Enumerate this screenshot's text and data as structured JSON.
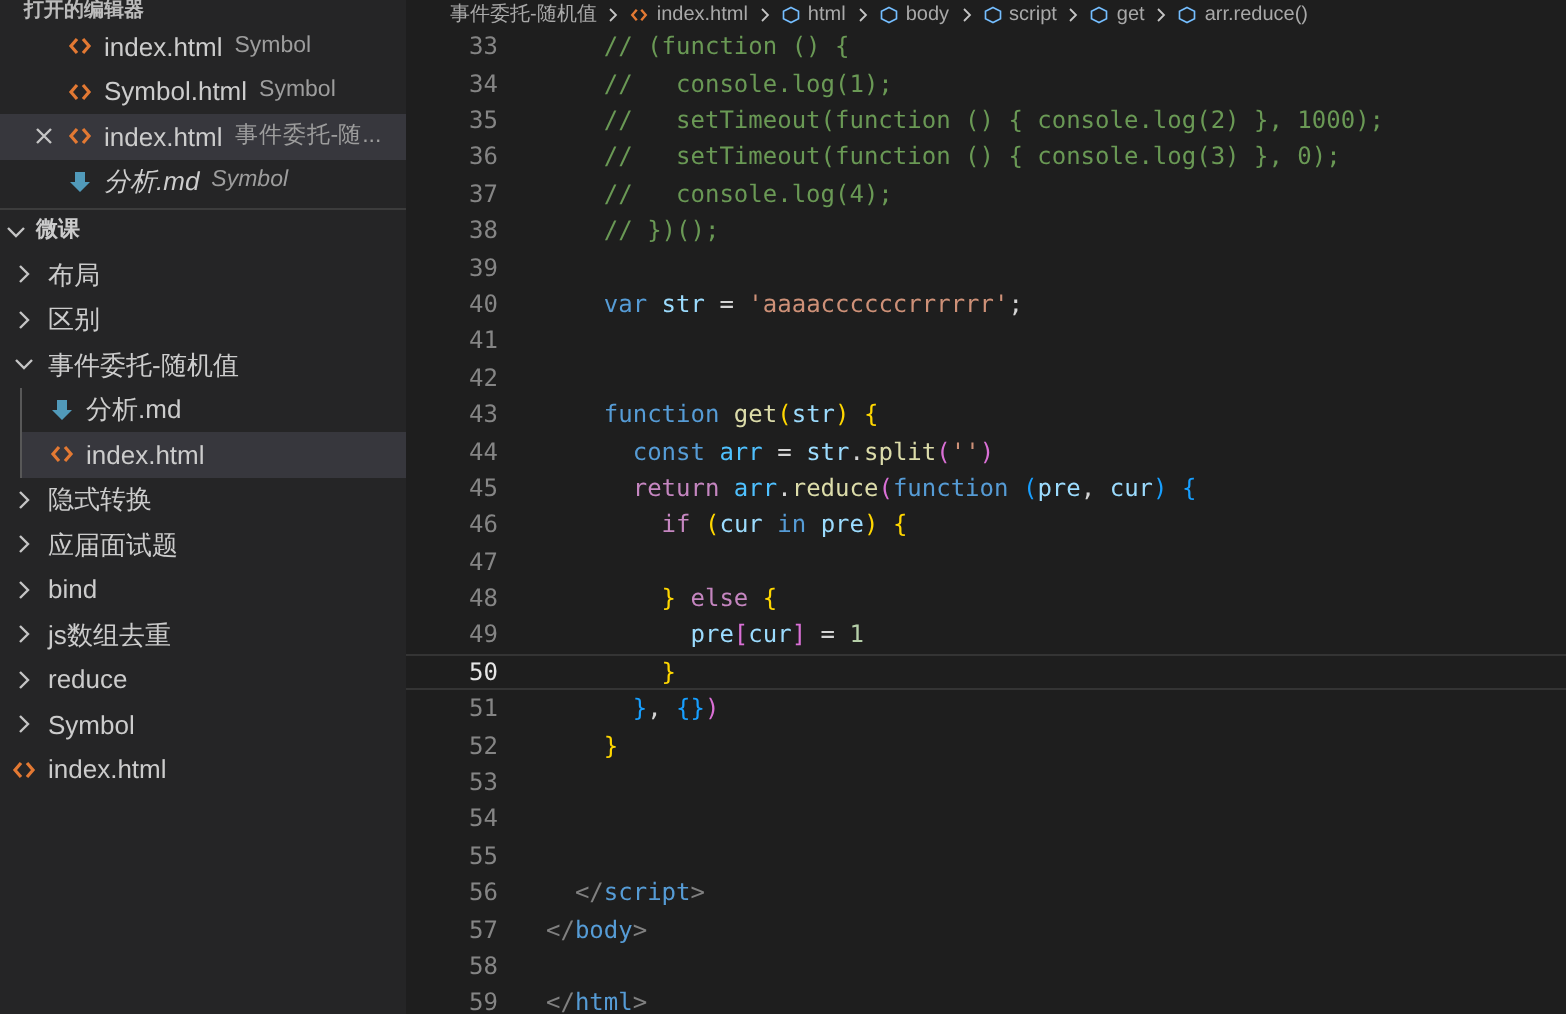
{
  "sidebar": {
    "open_editors": {
      "title": "打开的编辑器",
      "items": [
        {
          "kind": "html",
          "name": "index.html",
          "description": "Symbol",
          "selected": false,
          "preview": false
        },
        {
          "kind": "html",
          "name": "Symbol.html",
          "description": "Symbol",
          "selected": false,
          "preview": false
        },
        {
          "kind": "html",
          "name": "index.html",
          "description": "事件委托-随...",
          "selected": true,
          "preview": false
        },
        {
          "kind": "md",
          "name": "分析.md",
          "description": "Symbol",
          "selected": false,
          "preview": true
        }
      ]
    },
    "explorer": {
      "name": "微课",
      "expanded": true,
      "children": [
        {
          "kind": "folder",
          "name": "布局",
          "expanded": false,
          "selected": false
        },
        {
          "kind": "folder",
          "name": "区别",
          "expanded": false,
          "selected": false
        },
        {
          "kind": "folder",
          "name": "事件委托-随机值",
          "expanded": true,
          "selected": false,
          "children": [
            {
              "kind": "md",
              "name": "分析.md",
              "selected": false
            },
            {
              "kind": "html",
              "name": "index.html",
              "selected": true
            }
          ]
        },
        {
          "kind": "folder",
          "name": "隐式转换",
          "expanded": false,
          "selected": false
        },
        {
          "kind": "folder",
          "name": "应届面试题",
          "expanded": false,
          "selected": false
        },
        {
          "kind": "folder",
          "name": "bind",
          "expanded": false,
          "selected": false
        },
        {
          "kind": "folder",
          "name": "js数组去重",
          "expanded": false,
          "selected": false
        },
        {
          "kind": "folder",
          "name": "reduce",
          "expanded": false,
          "selected": false
        },
        {
          "kind": "folder",
          "name": "Symbol",
          "expanded": false,
          "selected": false
        },
        {
          "kind": "html",
          "name": "index.html",
          "selected": false
        }
      ]
    }
  },
  "editor": {
    "breadcrumbs": [
      "事件委托-随机值",
      "index.html",
      "html",
      "body",
      "script",
      "get",
      "arr.reduce()"
    ],
    "lines": [
      {
        "number": "33",
        "current": false,
        "tokens": [
          {
            "kind": "comment",
            "text": "    // (function () {"
          }
        ]
      },
      {
        "number": "34",
        "current": false,
        "tokens": [
          {
            "kind": "comment",
            "text": "    //   console.log(1);"
          }
        ]
      },
      {
        "number": "35",
        "current": false,
        "tokens": [
          {
            "kind": "comment",
            "text": "    //   setTimeout(function () { console.log(2) }, 1000);"
          }
        ]
      },
      {
        "number": "36",
        "current": false,
        "tokens": [
          {
            "kind": "comment",
            "text": "    //   setTimeout(function () { console.log(3) }, 0);"
          }
        ]
      },
      {
        "number": "37",
        "current": false,
        "tokens": [
          {
            "kind": "comment",
            "text": "    //   console.log(4);"
          }
        ]
      },
      {
        "number": "38",
        "current": false,
        "tokens": [
          {
            "kind": "comment",
            "text": "    // })();"
          }
        ]
      },
      {
        "number": "39",
        "current": false
      },
      {
        "number": "40",
        "current": false,
        "tokens": [
          {
            "kind": "keyword",
            "text": "    var "
          },
          {
            "kind": "variable",
            "text": "str"
          },
          {
            "kind": "plain",
            "text": " = "
          },
          {
            "kind": "string",
            "text": "'aaaaccccccrrrrrr'"
          },
          {
            "kind": "plain",
            "text": ";"
          }
        ]
      },
      {
        "number": "41",
        "current": false
      },
      {
        "number": "42",
        "current": false
      },
      {
        "number": "43",
        "current": false,
        "tokens": [
          {
            "kind": "keyword",
            "text": "    function "
          },
          {
            "kind": "function",
            "text": "get"
          },
          {
            "kind": "bracket1",
            "text": "("
          },
          {
            "kind": "variable",
            "text": "str"
          },
          {
            "kind": "bracket1",
            "text": ")"
          },
          {
            "kind": "bracket1",
            "text": " {"
          }
        ]
      },
      {
        "number": "44",
        "current": false,
        "tokens": [
          {
            "kind": "keyword",
            "text": "      const "
          },
          {
            "kind": "constant",
            "text": "arr"
          },
          {
            "kind": "plain",
            "text": " = "
          },
          {
            "kind": "variable",
            "text": "str"
          },
          {
            "kind": "plain",
            "text": "."
          },
          {
            "kind": "function",
            "text": "split"
          },
          {
            "kind": "bracket2",
            "text": "("
          },
          {
            "kind": "string",
            "text": "''"
          },
          {
            "kind": "bracket2",
            "text": ")"
          }
        ]
      },
      {
        "number": "45",
        "current": false,
        "tokens": [
          {
            "kind": "control",
            "text": "      return "
          },
          {
            "kind": "constant",
            "text": "arr"
          },
          {
            "kind": "plain",
            "text": "."
          },
          {
            "kind": "function",
            "text": "reduce"
          },
          {
            "kind": "bracket2",
            "text": "("
          },
          {
            "kind": "keyword",
            "text": "function "
          },
          {
            "kind": "bracket3",
            "text": "("
          },
          {
            "kind": "variable",
            "text": "pre"
          },
          {
            "kind": "plain",
            "text": ", "
          },
          {
            "kind": "variable",
            "text": "cur"
          },
          {
            "kind": "bracket3",
            "text": ")"
          },
          {
            "kind": "bracket3",
            "text": " {"
          }
        ]
      },
      {
        "number": "46",
        "current": false,
        "tokens": [
          {
            "kind": "control",
            "text": "        if "
          },
          {
            "kind": "bracket1",
            "text": "("
          },
          {
            "kind": "variable",
            "text": "cur"
          },
          {
            "kind": "keyword",
            "text": " in "
          },
          {
            "kind": "variable",
            "text": "pre"
          },
          {
            "kind": "bracket1",
            "text": ")"
          },
          {
            "kind": "bracket1",
            "text": " {"
          }
        ]
      },
      {
        "number": "47",
        "current": false
      },
      {
        "number": "48",
        "current": false,
        "tokens": [
          {
            "kind": "bracket1",
            "text": "        }"
          },
          {
            "kind": "control",
            "text": " else "
          },
          {
            "kind": "bracket1",
            "text": "{"
          }
        ]
      },
      {
        "number": "49",
        "current": false,
        "tokens": [
          {
            "kind": "variable",
            "text": "          pre"
          },
          {
            "kind": "bracket2",
            "text": "["
          },
          {
            "kind": "variable",
            "text": "cur"
          },
          {
            "kind": "bracket2",
            "text": "]"
          },
          {
            "kind": "plain",
            "text": " = "
          },
          {
            "kind": "number",
            "text": "1"
          }
        ]
      },
      {
        "number": "50",
        "current": true,
        "tokens": [
          {
            "kind": "bracket1",
            "text": "        }"
          }
        ]
      },
      {
        "number": "51",
        "current": false,
        "tokens": [
          {
            "kind": "bracket3",
            "text": "      }"
          },
          {
            "kind": "plain",
            "text": ", "
          },
          {
            "kind": "bracket3",
            "text": "{}"
          },
          {
            "kind": "bracket2",
            "text": ")"
          }
        ]
      },
      {
        "number": "52",
        "current": false,
        "tokens": [
          {
            "kind": "bracket1",
            "text": "    }"
          }
        ]
      },
      {
        "number": "53",
        "current": false
      },
      {
        "number": "54",
        "current": false
      },
      {
        "number": "55",
        "current": false
      },
      {
        "number": "56",
        "current": false,
        "tokens": [
          {
            "kind": "tag",
            "text": "  </"
          },
          {
            "kind": "tagname",
            "text": "script"
          },
          {
            "kind": "tag",
            "text": ">"
          }
        ]
      },
      {
        "number": "57",
        "current": false,
        "tokens": [
          {
            "kind": "tag",
            "text": "</"
          },
          {
            "kind": "tagname",
            "text": "body"
          },
          {
            "kind": "tag",
            "text": ">"
          }
        ]
      },
      {
        "number": "58",
        "current": false
      },
      {
        "number": "59",
        "current": false,
        "tokens": [
          {
            "kind": "tag",
            "text": "</"
          },
          {
            "kind": "tagname",
            "text": "html"
          },
          {
            "kind": "tag",
            "text": ">"
          }
        ]
      }
    ]
  }
}
